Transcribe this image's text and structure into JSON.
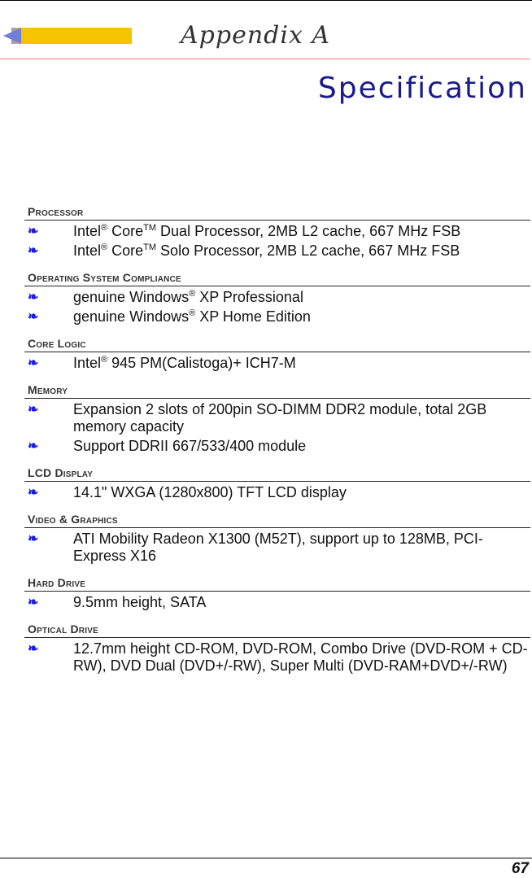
{
  "header": {
    "appendix_label": "Appendix  A",
    "page_title": "Specification"
  },
  "bullet_glyph": "❧",
  "sections": [
    {
      "id": "processor",
      "heading": "Processor",
      "items": [
        {
          "parts": [
            "Intel",
            "®",
            " Core",
            "TM",
            " Dual Processor, 2MB L2 cache, 667 MHz FSB"
          ]
        },
        {
          "parts": [
            "Intel",
            "®",
            " Core",
            "TM",
            " Solo Processor, 2MB L2 cache, 667 MHz FSB"
          ]
        }
      ]
    },
    {
      "id": "os",
      "heading": "Operating System Compliance",
      "items": [
        {
          "parts": [
            "genuine Windows",
            "®",
            " XP Professional"
          ]
        },
        {
          "parts": [
            "genuine Windows",
            "®",
            " XP Home Edition"
          ]
        }
      ]
    },
    {
      "id": "core-logic",
      "heading": "Core Logic",
      "items": [
        {
          "parts": [
            "Intel",
            "®",
            " 945 PM(Calistoga)+ ICH7-M"
          ]
        }
      ]
    },
    {
      "id": "memory",
      "heading": "Memory",
      "items": [
        {
          "parts": [
            "Expansion 2 slots of 200pin SO-DIMM DDR2 module, total 2GB memory capacity"
          ]
        },
        {
          "parts": [
            "Support DDRII 667/533/400 module"
          ]
        }
      ]
    },
    {
      "id": "lcd",
      "heading": "LCD Display",
      "items": [
        {
          "parts": [
            "14.1\" WXGA (1280x800) TFT LCD display"
          ]
        }
      ]
    },
    {
      "id": "video",
      "heading": "Video & Graphics",
      "items": [
        {
          "parts": [
            "ATI Mobility Radeon X1300 (M52T), support up to 128MB, PCI-Express X16"
          ]
        }
      ]
    },
    {
      "id": "hdd",
      "heading": "Hard Drive",
      "items": [
        {
          "parts": [
            "9.5mm height, SATA"
          ]
        }
      ]
    },
    {
      "id": "optical",
      "heading": "Optical Drive",
      "items": [
        {
          "parts": [
            "12.7mm height CD-ROM, DVD-ROM, Combo Drive (DVD-ROM + CD-RW), DVD Dual (DVD+/-RW), Super Multi (DVD-RAM+DVD+/-RW)"
          ]
        }
      ]
    }
  ],
  "footer": {
    "page_number": "67"
  },
  "colors": {
    "title": "#1a1a8c",
    "bullet": "#1a1ae6",
    "banner_bar": "#f5c400",
    "red_rule": "#e07a7a"
  }
}
